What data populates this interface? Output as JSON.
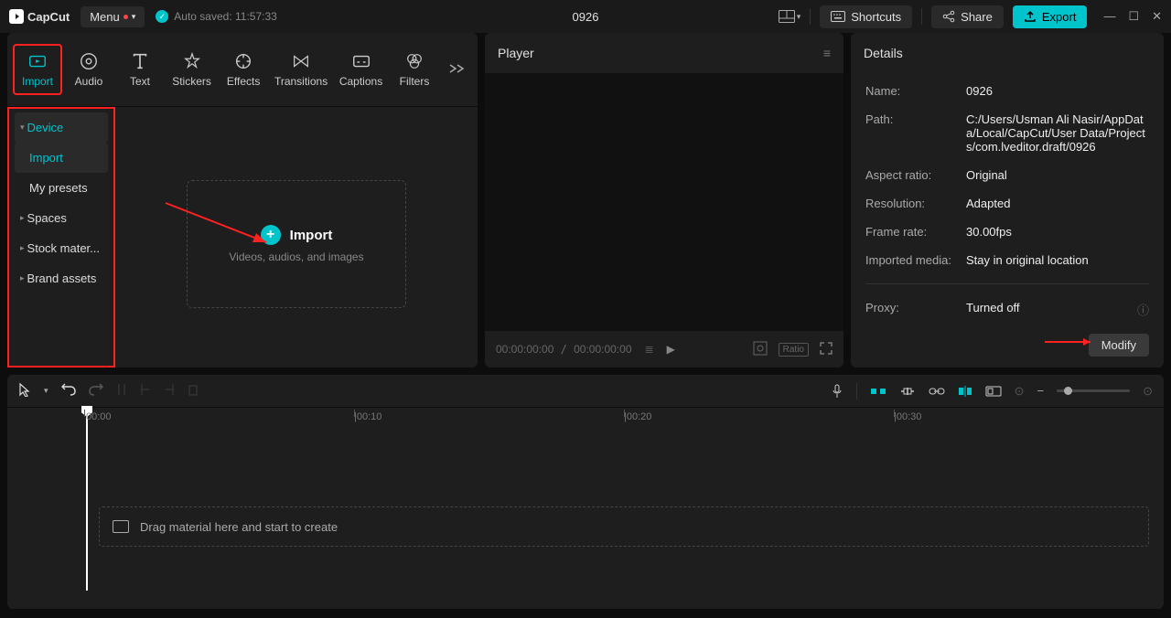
{
  "app": {
    "name": "CapCut"
  },
  "menu": {
    "label": "Menu"
  },
  "autosave": {
    "text": "Auto saved: 11:57:33"
  },
  "project": {
    "title": "0926"
  },
  "topbar": {
    "shortcuts": "Shortcuts",
    "share": "Share",
    "export": "Export"
  },
  "tabs": {
    "import": "Import",
    "audio": "Audio",
    "text": "Text",
    "stickers": "Stickers",
    "effects": "Effects",
    "transitions": "Transitions",
    "captions": "Captions",
    "filters": "Filters"
  },
  "sidebar": {
    "device": "Device",
    "import": "Import",
    "presets": "My presets",
    "spaces": "Spaces",
    "stock": "Stock mater...",
    "brand": "Brand assets"
  },
  "importBox": {
    "title": "Import",
    "sub": "Videos, audios, and images"
  },
  "player": {
    "title": "Player",
    "time_current": "00:00:00:00",
    "time_total": "00:00:00:00",
    "ratio": "Ratio"
  },
  "details": {
    "title": "Details",
    "name_label": "Name:",
    "name_value": "0926",
    "path_label": "Path:",
    "path_value": "C:/Users/Usman Ali Nasir/AppData/Local/CapCut/User Data/Projects/com.lveditor.draft/0926",
    "aspect_label": "Aspect ratio:",
    "aspect_value": "Original",
    "res_label": "Resolution:",
    "res_value": "Adapted",
    "fps_label": "Frame rate:",
    "fps_value": "30.00fps",
    "media_label": "Imported media:",
    "media_value": "Stay in original location",
    "proxy_label": "Proxy:",
    "proxy_value": "Turned off",
    "modify": "Modify"
  },
  "timeline": {
    "t0": "00:00",
    "t1": "00:10",
    "t2": "00:20",
    "t3": "00:30",
    "drop": "Drag material here and start to create"
  }
}
